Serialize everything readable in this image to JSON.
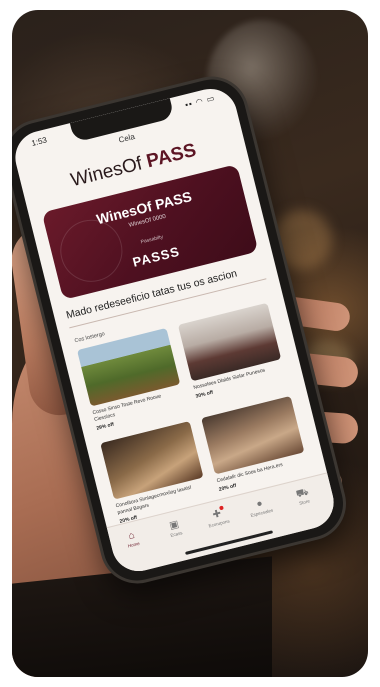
{
  "status_bar": {
    "time": "1:53",
    "icons": "▪▪ ◠ ▭"
  },
  "nav": {
    "title": "Cela"
  },
  "brand": {
    "prefix": "WinesOf",
    "bold": "PASS"
  },
  "hero": {
    "title": "WinesOf PASS",
    "subtitle": "WinesOf 0000",
    "caption": "Passabilty",
    "cta": "PASSS"
  },
  "headline": "Mado redeseeficio tatas tus os ascion",
  "section_label": "Cos lostergo",
  "cards": [
    {
      "text": "Cosso Sinso Toste Revo Rooue Ciessiocs",
      "price": "29% off"
    },
    {
      "text": "Nossolees Dlalds Siolar Punesos",
      "price": "30% off"
    },
    {
      "text": "Conolitora Simlagecmoxiiog Iasaisl pannal Bogars",
      "price": "20% off"
    },
    {
      "text": "Cedalalir dic Soos ba Hera.ers",
      "price": "20% off"
    }
  ],
  "tabs": [
    {
      "label": "Home",
      "icon": "house-icon"
    },
    {
      "label": "Ecass",
      "icon": "wallet-icon"
    },
    {
      "label": "Ecorupons",
      "icon": "gift-icon"
    },
    {
      "label": "Especsales",
      "icon": "person-icon"
    },
    {
      "label": "Store",
      "icon": "cart-icon"
    }
  ],
  "colors": {
    "accent": "#5c1524",
    "screen_bg": "#f7f3ef"
  }
}
